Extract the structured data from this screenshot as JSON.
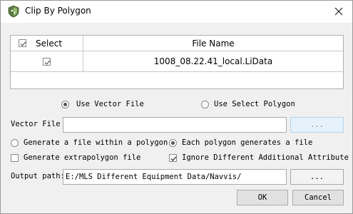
{
  "window": {
    "title": "Clip By Polygon",
    "icon": "app-shield-icon"
  },
  "table": {
    "header_select": "Select",
    "header_filename": "File Name",
    "header_checked": true,
    "rows": [
      {
        "checked": true,
        "filename": "1008_08.22.41_local.LiData"
      }
    ]
  },
  "source": {
    "use_vector_file_label": "Use Vector File",
    "use_select_polygon_label": "Use Select Polygon",
    "selected": "use_vector_file"
  },
  "vector_file": {
    "label": "Vector File",
    "value": "",
    "browse_label": "..."
  },
  "mode": {
    "generate_within_label": "Generate a file within a polygon",
    "each_polygon_label": "Each polygon generates a file",
    "selected": "each_polygon"
  },
  "options": {
    "extrapolygon_label": "Generate extrapolygon file",
    "extrapolygon_checked": false,
    "ignore_attr_label": "Ignore Different Additional Attribute",
    "ignore_attr_checked": true
  },
  "output": {
    "label": "Output path:",
    "value": "E:/MLS Different Equipment Data/Navvis/",
    "browse_label": "..."
  },
  "buttons": {
    "ok": "OK",
    "cancel": "Cancel"
  }
}
